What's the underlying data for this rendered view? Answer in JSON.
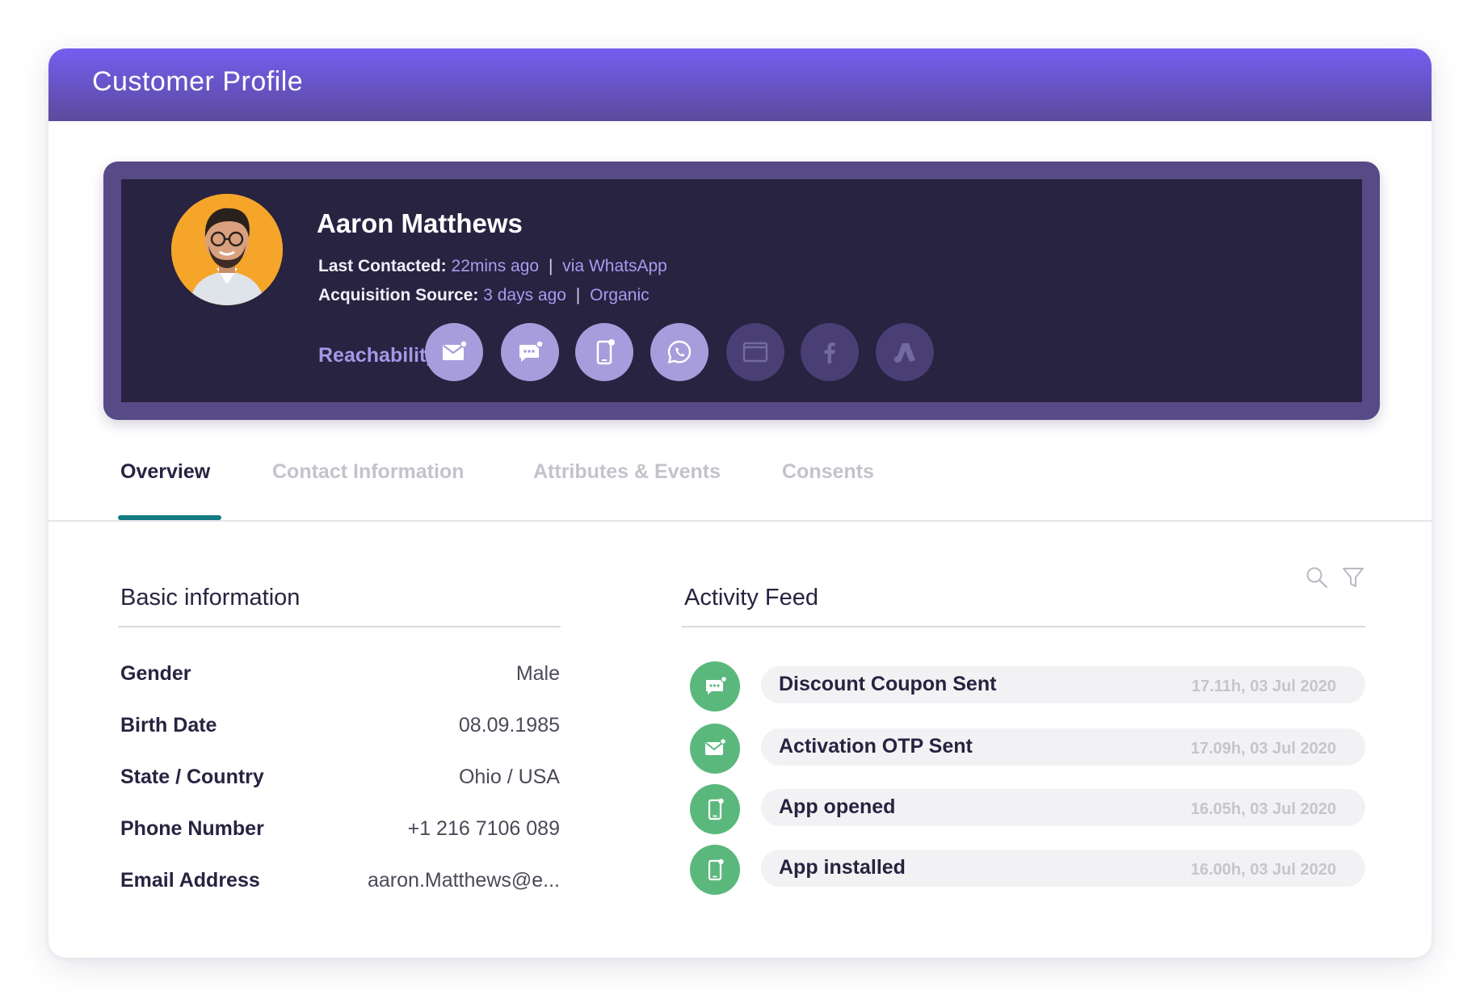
{
  "header": {
    "title": "Customer Profile"
  },
  "profile": {
    "name": "Aaron Matthews",
    "last_contacted_label": "Last Contacted:",
    "last_contacted_time": "22mins ago",
    "last_contacted_separator": "|",
    "last_contacted_via": "via WhatsApp",
    "acquisition_label": "Acquisition Source:",
    "acquisition_time": "3 days ago",
    "acquisition_separator": "|",
    "acquisition_source": "Organic",
    "reachability_label": "Reachability",
    "channels": [
      {
        "icon": "email-icon",
        "active": true
      },
      {
        "icon": "sms-icon",
        "active": true
      },
      {
        "icon": "mobile-push-icon",
        "active": true
      },
      {
        "icon": "whatsapp-icon",
        "active": true
      },
      {
        "icon": "web-push-icon",
        "active": false
      },
      {
        "icon": "facebook-icon",
        "active": false
      },
      {
        "icon": "google-ads-icon",
        "active": false
      }
    ]
  },
  "tabs": [
    {
      "label": "Overview",
      "active": true
    },
    {
      "label": "Contact Information",
      "active": false
    },
    {
      "label": "Attributes & Events",
      "active": false
    },
    {
      "label": "Consents",
      "active": false
    }
  ],
  "basic_info": {
    "title": "Basic information",
    "rows": [
      {
        "label": "Gender",
        "value": "Male"
      },
      {
        "label": "Birth Date",
        "value": "08.09.1985"
      },
      {
        "label": "State / Country",
        "value": "Ohio / USA"
      },
      {
        "label": "Phone Number",
        "value": "+1 216 7106 089"
      },
      {
        "label": "Email Address",
        "value": "aaron.Matthews@e..."
      }
    ]
  },
  "activity_feed": {
    "title": "Activity Feed",
    "tools": [
      "search-icon",
      "filter-icon"
    ],
    "items": [
      {
        "icon": "sms-icon",
        "text": "Discount Coupon Sent",
        "time": "17.11h, 03 Jul 2020"
      },
      {
        "icon": "email-icon",
        "text": "Activation OTP Sent",
        "time": "17.09h, 03 Jul 2020"
      },
      {
        "icon": "mobile-icon",
        "text": "App opened",
        "time": "16.05h, 03 Jul 2020"
      },
      {
        "icon": "mobile-icon",
        "text": "App installed",
        "time": "16.00h, 03 Jul 2020"
      }
    ]
  },
  "colors": {
    "header_gradient_top": "#755ef1",
    "header_gradient_bottom": "#5b4a9c",
    "profile_dark": "#272340",
    "profile_frame": "#574a87",
    "accent_value": "#a99bf0",
    "channel_active": "#a79ddc",
    "channel_inactive": "#4a3f75",
    "tab_underline": "#127a80",
    "feed_icon_green": "#5bb87c"
  }
}
